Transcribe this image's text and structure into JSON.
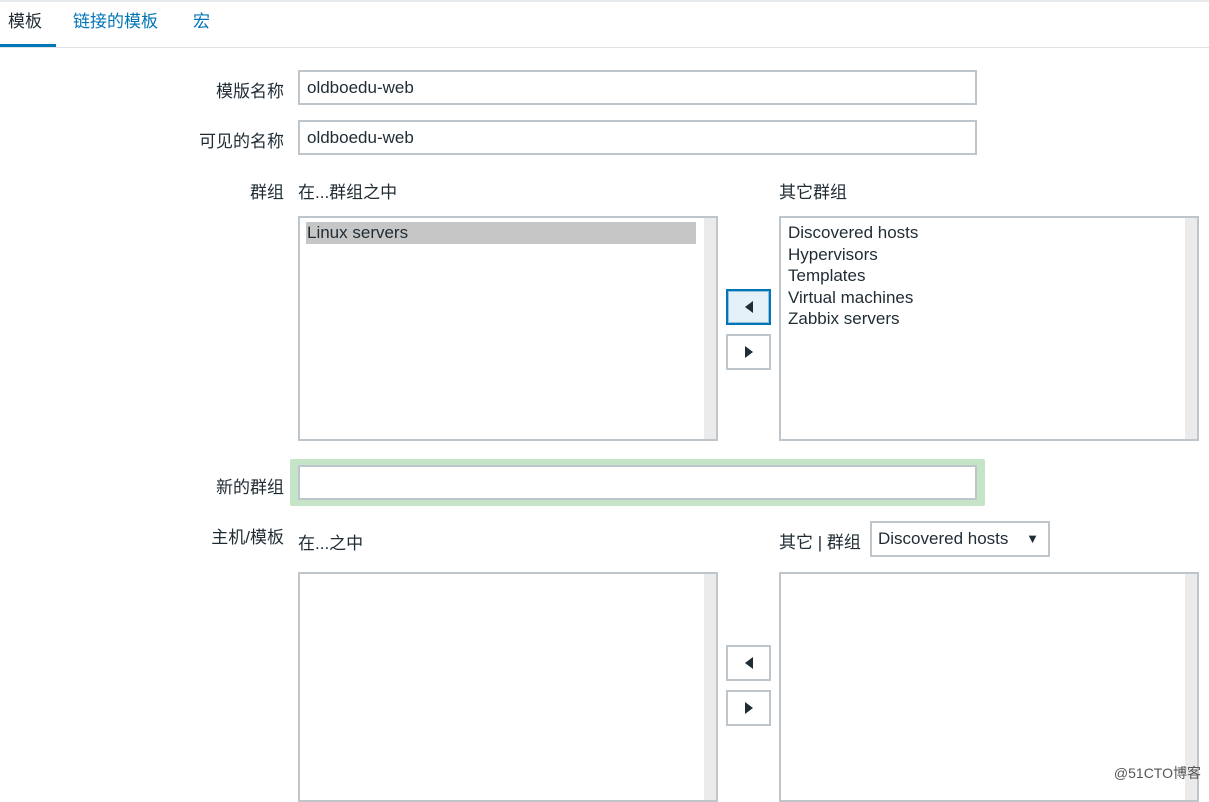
{
  "tabs": [
    {
      "label": "模板",
      "active": true
    },
    {
      "label": "链接的模板",
      "active": false
    },
    {
      "label": "宏",
      "active": false
    }
  ],
  "form": {
    "template_name_label": "模版名称",
    "template_name_value": "oldboedu-web",
    "visible_name_label": "可见的名称",
    "visible_name_value": "oldboedu-web",
    "groups_label": "群组",
    "in_groups_title": "在...群组之中",
    "other_groups_title": "其它群组",
    "in_groups": [
      "Linux servers"
    ],
    "other_groups": [
      "Discovered hosts",
      "Hypervisors",
      "Templates",
      "Virtual machines",
      "Zabbix servers"
    ],
    "new_group_label": "新的群组",
    "new_group_value": "",
    "hosts_label": "主机/模板",
    "in_hosts_title": "在...之中",
    "other_hosts_title": "其它 | 群组",
    "group_select_value": "Discovered hosts",
    "select_caret": "▼"
  },
  "watermark": "@51CTO博客",
  "colors": {
    "accent": "#0275b8",
    "focus_ring": "#c5e4c8",
    "selected_item": "#c6c6c6"
  }
}
